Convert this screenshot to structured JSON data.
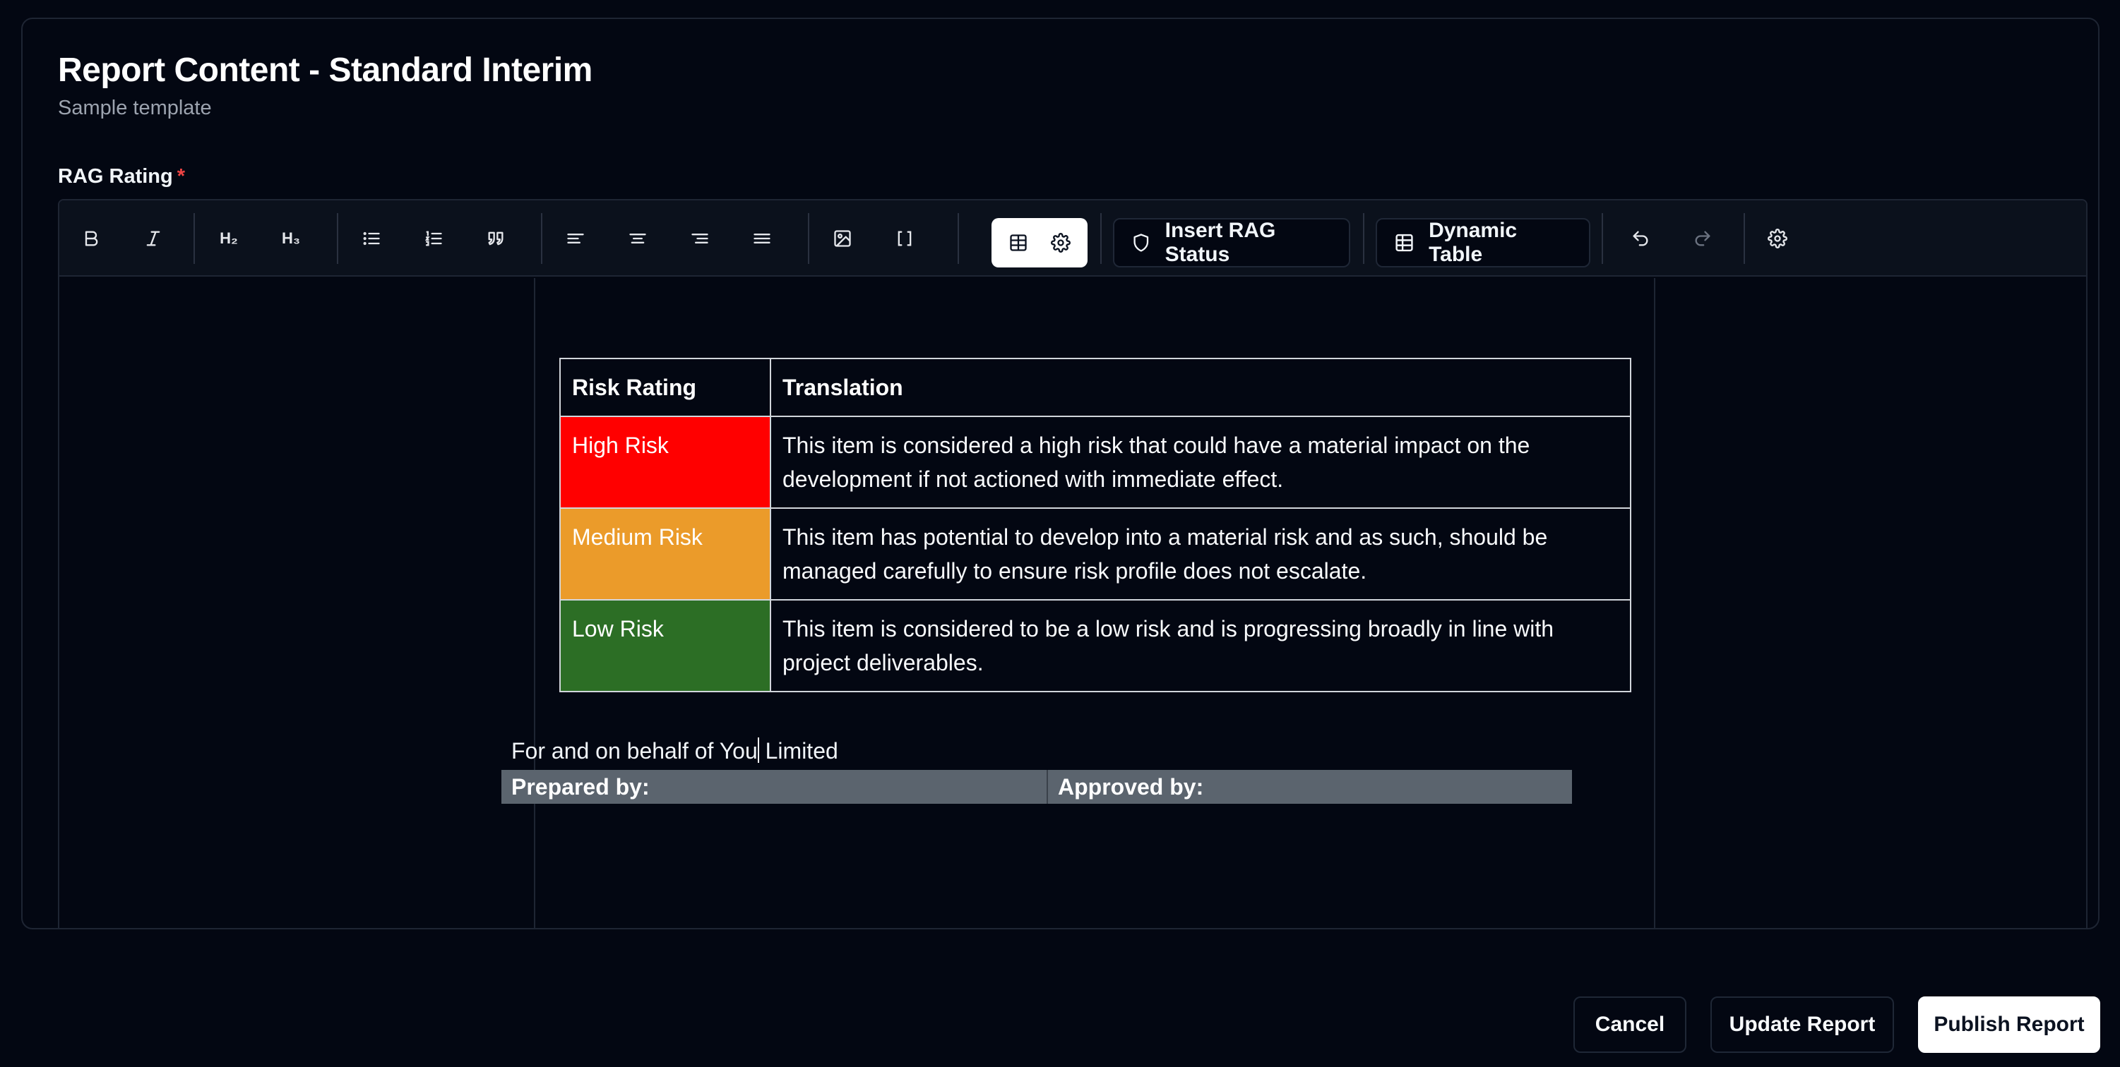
{
  "header": {
    "title": "Report Content - Standard Interim",
    "subtitle": "Sample template"
  },
  "field": {
    "label": "RAG Rating",
    "required_marker": "*"
  },
  "toolbar": {
    "heading2": "H₂",
    "heading3": "H₃",
    "insert_rag_status": "Insert RAG Status",
    "dynamic_table": "Dynamic Table",
    "icons": [
      "bold-icon",
      "italic-icon",
      "bullet-list-icon",
      "ordered-list-icon",
      "quote-icon",
      "align-left-icon",
      "align-center-icon",
      "align-right-icon",
      "align-justify-icon",
      "image-icon",
      "brackets-icon",
      "table-icon",
      "gear-icon",
      "shield-icon",
      "undo-icon",
      "redo-icon"
    ]
  },
  "rag_table": {
    "headers": [
      "Risk Rating",
      "Translation"
    ],
    "rows": [
      {
        "rating": "High Risk",
        "color": "#ff0000",
        "translation": "This item is considered a high risk that could have a material impact on the development if not actioned with immediate effect."
      },
      {
        "rating": "Medium Risk",
        "color": "#eb9b2a",
        "translation": "This item has potential to develop into a material risk and as such, should be managed carefully to ensure risk profile does not escalate."
      },
      {
        "rating": "Low Risk",
        "color": "#2c6e25",
        "translation": "This item is considered to be a low risk and is progressing broadly in line with project deliverables."
      }
    ]
  },
  "document": {
    "behalf_before_caret": "For and on behalf of You",
    "behalf_after_caret": " Limited",
    "prepared_by": "Prepared by:",
    "approved_by": "Approved by:"
  },
  "footer": {
    "cancel": "Cancel",
    "update": "Update Report",
    "publish": "Publish Report"
  },
  "colors": {
    "background": "#030712",
    "primary_button": "#ffffff",
    "required": "#ef4444",
    "sign_bar": "#5b646e"
  }
}
